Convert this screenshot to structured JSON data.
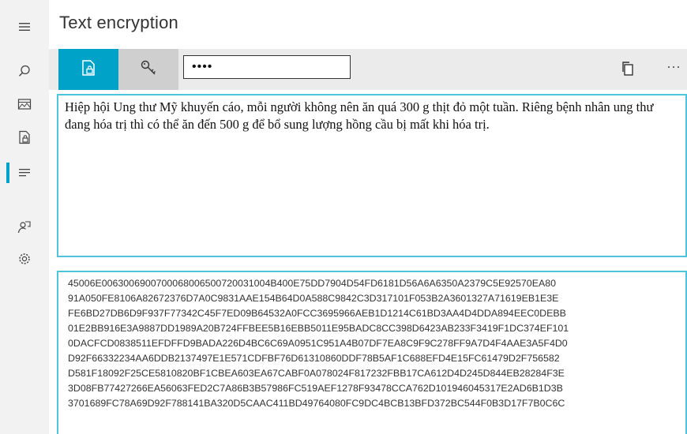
{
  "app": {
    "title": "Text encryption"
  },
  "rail": {
    "items": [
      {
        "icon": "hamburger-menu-icon"
      },
      {
        "icon": "search-icon"
      },
      {
        "icon": "image-icon"
      },
      {
        "icon": "file-lock-icon"
      },
      {
        "icon": "text-lines-icon",
        "selected": true
      },
      {
        "icon": "person-share-icon"
      },
      {
        "icon": "gear-icon"
      }
    ]
  },
  "toolbar": {
    "encrypt_icon": "file-lock-icon",
    "key_icon": "key-icon",
    "password_value": "••••",
    "copy_icon": "copy-icon",
    "more_label": "···"
  },
  "plain_text": "Hiệp hội Ung thư Mỹ khuyến cáo, mỗi người không nên ăn quá 300 g thịt đỏ một tuần. Riêng bệnh nhân ung thư đang hóa trị thì có thể ăn đến 500 g để bổ sung lượng hồng cầu bị mất khi hóa trị.",
  "cipher_lines": [
    "45006E0063006900700068006500720031004B400E75DD7904D54FD6181D56A6A6350A2379C5E92570EA80",
    "91A050FE8106A82672376D7A0C9831AAE154B64D0A588C9842C3D317101F053B2A3601327A71619EB1E3E",
    "FE6BD27DB6D9F937F77342C45F7ED09B64532A0FCC3695966AEB1D1214C61BD3AA4D4DDA894EEC0DEBB",
    "01E2BB916E3A9887DD1989A20B724FFBEE5B16EBB5011E95BADC8CC398D6423AB233F3419F1DC374EF101",
    "0DACFCD0838511EFDFFD9BADA226D4BC6C69A0951C951A4B07DF7EA8C9F9C278FF9A7D4F4AAE3A5F4D0",
    "D92F66332234AA6DDB2137497E1E571CDFBF76D61310860DDF78B5AF1C688EFD4E15FC61479D2F756582",
    "D581F18092F25CE5810820BF1CBEA603EA67CABF0A078024F817232FBB17CA612D4D245D844EB28284F3E",
    "3D08FB77427266EA56063FED2C7A86B3B57986FC519AEF1278F93478CCA762D101946045317E2AD6B1D3B",
    "3701689FC78A69D92F788141BA320D5CAAC411BD49764080FC9DC4BCB13BFD372BC544F0B3D17F7B0C6C"
  ],
  "colors": {
    "accent": "#00a2c8",
    "border": "#4fc4dc",
    "rail_bg": "#f2f2f2"
  }
}
